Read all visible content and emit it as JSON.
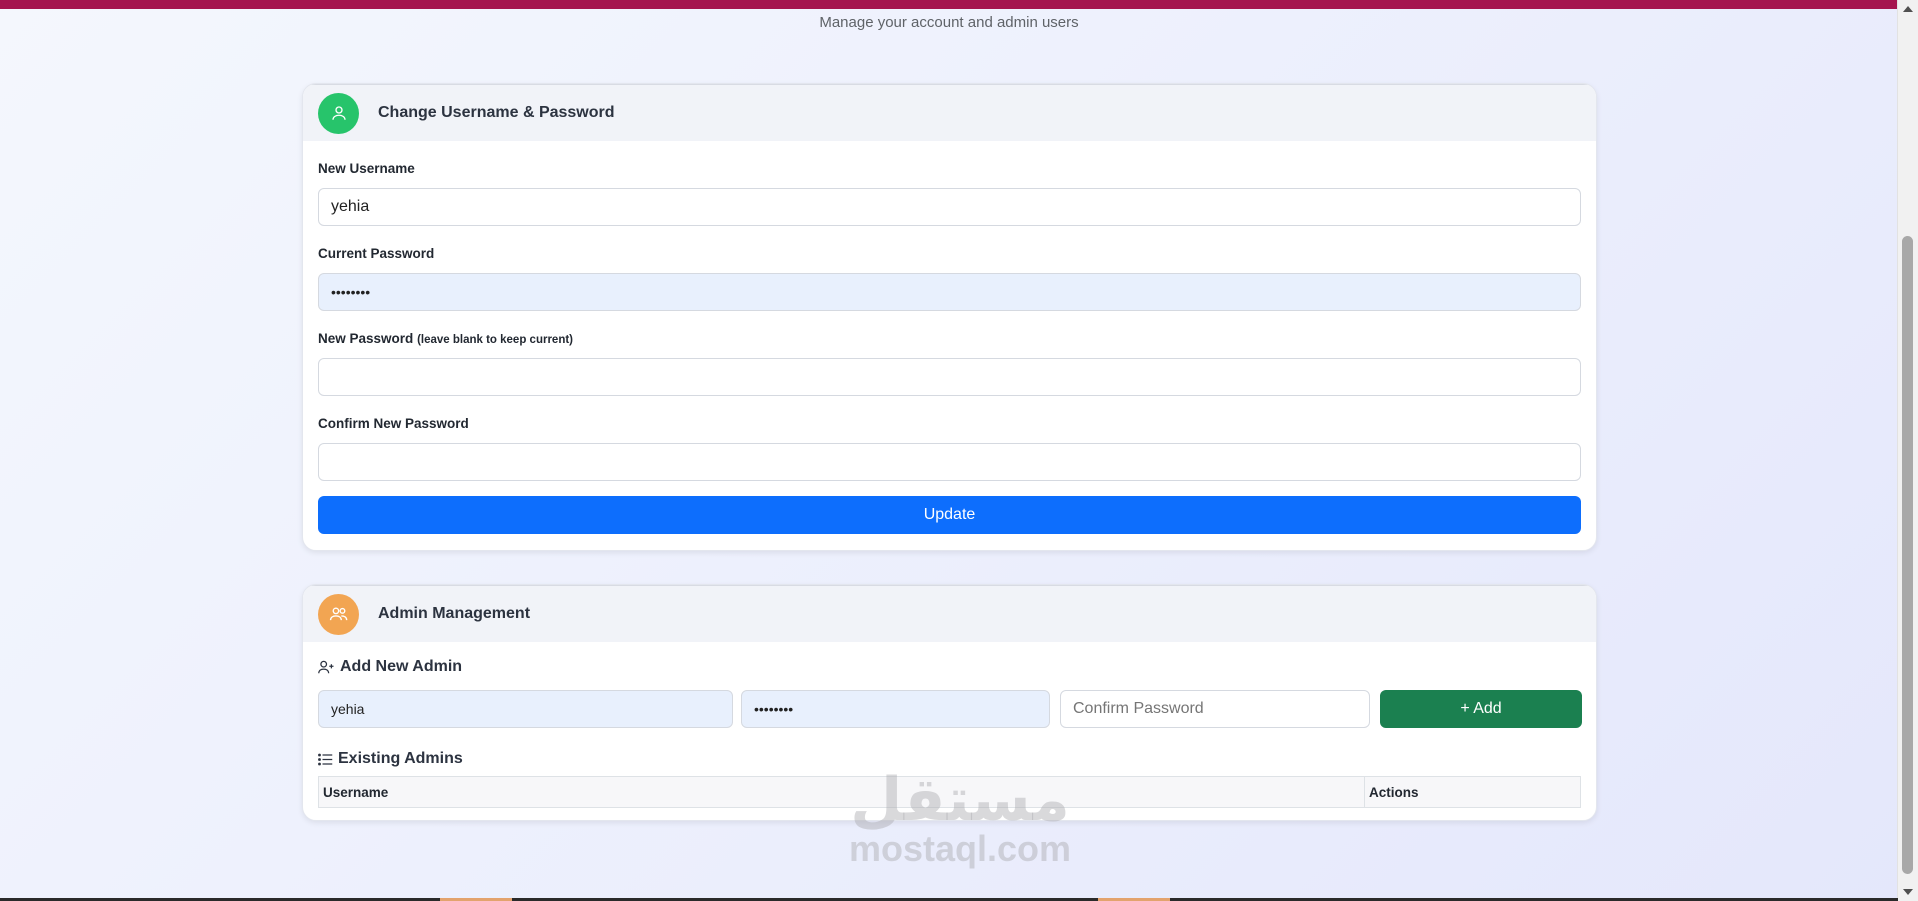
{
  "header": {
    "subtitle": "Manage your account and admin users"
  },
  "account_card": {
    "title": "Change Username & Password",
    "icon": "user-icon",
    "username_label": "New Username",
    "username_value": "yehia",
    "current_password_label": "Current Password",
    "current_password_value": "••••••••",
    "new_password_label": "New Password",
    "new_password_hint": "(leave blank to keep current)",
    "new_password_value": "",
    "confirm_password_label": "Confirm New Password",
    "confirm_password_value": "",
    "update_button": "Update"
  },
  "admin_card": {
    "title": "Admin Management",
    "icon": "users-icon",
    "add_heading": "Add New Admin",
    "add_username_value": "yehia",
    "add_password_value": "••••••••",
    "confirm_placeholder": "Confirm Password",
    "add_button": "+ Add",
    "existing_heading": "Existing Admins",
    "table_columns": [
      "Username",
      "Actions"
    ],
    "table_rows": []
  },
  "watermark": {
    "arabic": "مستقل",
    "latin": "mostaql.com"
  },
  "colors": {
    "top_bar": "#a5154f",
    "primary": "#0d6efd",
    "success": "#1b8050",
    "avatar_green": "#27c46b",
    "avatar_orange": "#f2a552"
  }
}
